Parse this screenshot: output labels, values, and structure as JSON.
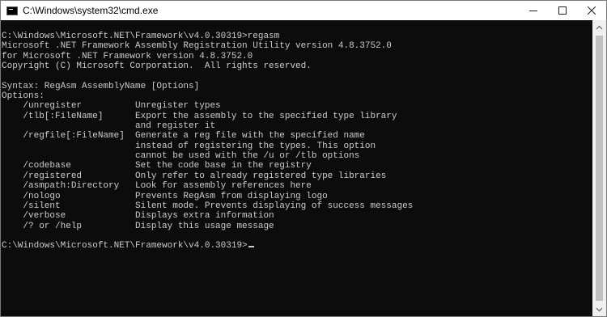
{
  "window": {
    "title": "C:\\Windows\\system32\\cmd.exe",
    "icon": "cmd-icon"
  },
  "controls": {
    "minimize": "minimize-icon",
    "maximize": "maximize-icon",
    "close": "close-icon"
  },
  "console": {
    "lines": [
      "C:\\Windows\\Microsoft.NET\\Framework\\v4.0.30319>regasm",
      "Microsoft .NET Framework Assembly Registration Utility version 4.8.3752.0",
      "for Microsoft .NET Framework version 4.8.3752.0",
      "Copyright (C) Microsoft Corporation.  All rights reserved.",
      "",
      "Syntax: RegAsm AssemblyName [Options]",
      "Options:",
      "    /unregister          Unregister types",
      "    /tlb[:FileName]      Export the assembly to the specified type library",
      "                         and register it",
      "    /regfile[:FileName]  Generate a reg file with the specified name",
      "                         instead of registering the types. This option",
      "                         cannot be used with the /u or /tlb options",
      "    /codebase            Set the code base in the registry",
      "    /registered          Only refer to already registered type libraries",
      "    /asmpath:Directory   Look for assembly references here",
      "    /nologo              Prevents RegAsm from displaying logo",
      "    /silent              Silent mode. Prevents displaying of success messages",
      "    /verbose             Displays extra information",
      "    /? or /help          Display this usage message",
      ""
    ],
    "prompt": "C:\\Windows\\Microsoft.NET\\Framework\\v4.0.30319>"
  },
  "colors": {
    "background": "#0c0c0c",
    "text": "#cccccc",
    "titlebar": "#ffffff"
  }
}
